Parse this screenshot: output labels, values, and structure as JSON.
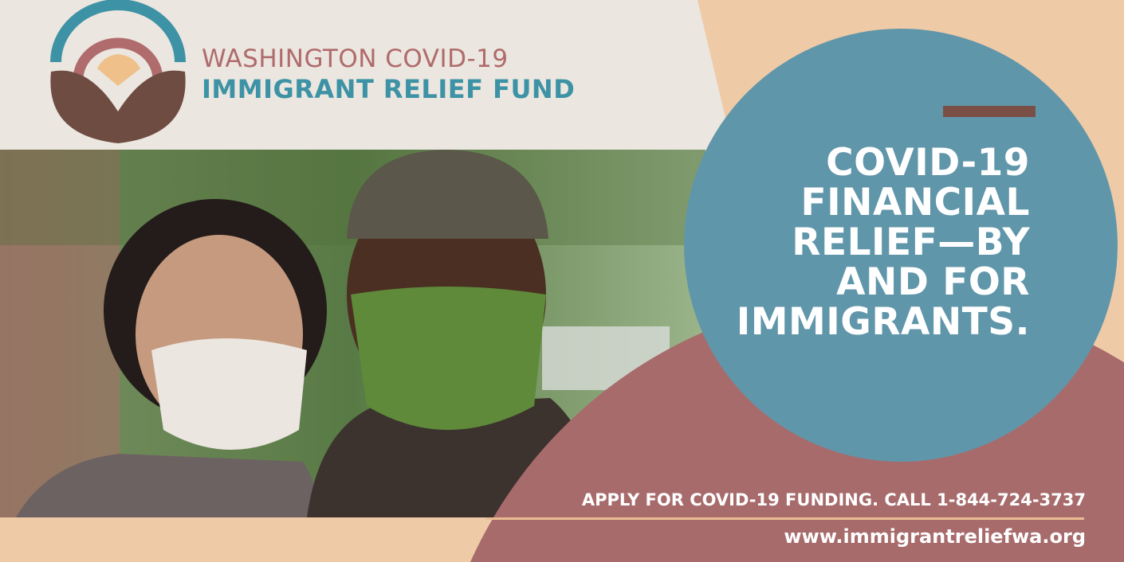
{
  "logo": {
    "line1": "WASHINGTON COVID-19",
    "line2": "IMMIGRANT RELIEF FUND"
  },
  "headline": [
    "COVID-19",
    "FINANCIAL",
    "RELIEF—BY",
    "AND FOR",
    "IMMIGRANTS."
  ],
  "cta": {
    "apply": "APPLY FOR COVID-19 FUNDING. CALL 1-844-724-3737",
    "url": "www.immigrantreliefwa.org"
  },
  "colors": {
    "teal": "#3d93a5",
    "rose": "#b06b6c",
    "brown": "#7a4f45",
    "peach": "#efcaa6",
    "circle_blue": "#6096aa",
    "mauve": "#a86b6c"
  }
}
